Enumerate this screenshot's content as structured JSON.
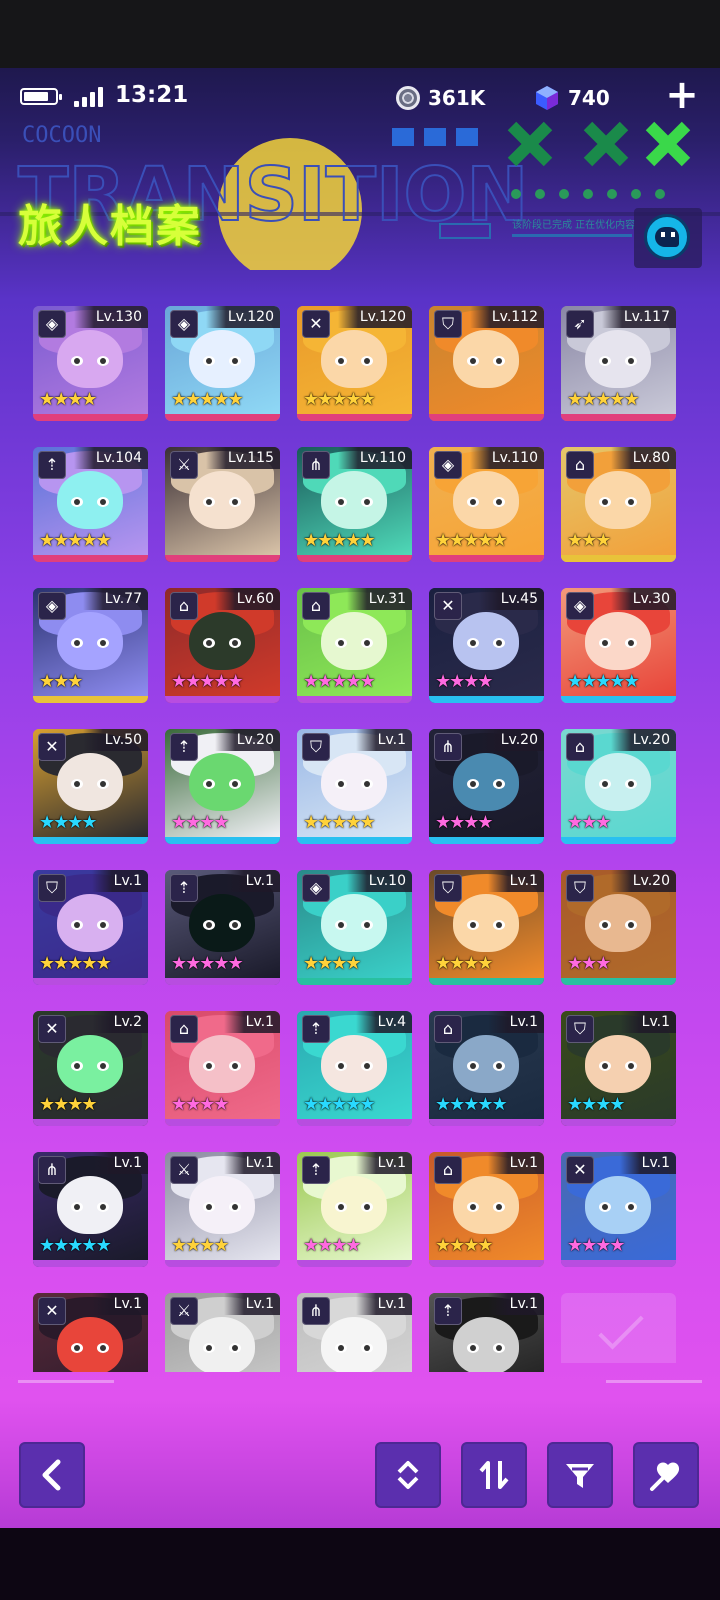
{
  "status_bar": {
    "time": "13:21",
    "battery_percent": 80
  },
  "currencies": {
    "coins": "361K",
    "gems": "740"
  },
  "header": {
    "title": "旅人档案",
    "banner_brand": "COCOON",
    "banner_word": "TRANSITION",
    "banner_subtext": "该阶段已完成  正在优化内容"
  },
  "colors": {
    "accent_lime": "#d7ff3a",
    "button_bg": "#5b2fae",
    "star_gold": "#ffd23a",
    "star_pink": "#ff6ae0",
    "star_cyan": "#29d9ff"
  },
  "characters": [
    {
      "level": "Lv.130",
      "class_icon": "diamond-icon",
      "stars": 4,
      "star_color": "#ffd23a",
      "hair": "#b27be0",
      "skin": "#d8a8f0",
      "bg": "#7a5bd0",
      "underline": "#e13f7c"
    },
    {
      "level": "Lv.120",
      "class_icon": "diamond-icon",
      "stars": 5,
      "star_color": "#ffd23a",
      "hair": "#8fd8f5",
      "skin": "#e6f0ff",
      "bg": "#6aa6d8",
      "underline": "#e13f7c"
    },
    {
      "level": "Lv.120",
      "class_icon": "crossed-swords-icon",
      "stars": 5,
      "star_color": "#ffd23a",
      "hair": "#f5b535",
      "skin": "#fbd7a8",
      "bg": "#e99a2a",
      "underline": "#e13f7c"
    },
    {
      "level": "Lv.112",
      "class_icon": "shield-icon",
      "stars": 0,
      "star_color": "#ff6ae0",
      "hair": "#f08a2a",
      "skin": "#fbd7a8",
      "bg": "#c9842f",
      "underline": "#e13f7c"
    },
    {
      "level": "Lv.117",
      "class_icon": "bow-icon",
      "stars": 5,
      "star_color": "#ffd23a",
      "hair": "#c9c9d8",
      "skin": "#e6e4ee",
      "bg": "#8a87a5",
      "underline": "#e13f7c"
    },
    {
      "level": "Lv.104",
      "class_icon": "crossbow-icon",
      "stars": 5,
      "star_color": "#ffd23a",
      "hair": "#b795f0",
      "skin": "#8ef0f0",
      "bg": "#5a72d8",
      "underline": "#e13f7c"
    },
    {
      "level": "Lv.115",
      "class_icon": "dagger-icon",
      "stars": 0,
      "star_color": "#ff6ae0",
      "hair": "#d9c3a8",
      "skin": "#f5e1cf",
      "bg": "#3a2f35",
      "underline": "#e13f7c"
    },
    {
      "level": "Lv.110",
      "class_icon": "trident-icon",
      "stars": 5,
      "star_color": "#ffd23a",
      "hair": "#4fd9b8",
      "skin": "#c5f5e6",
      "bg": "#1a5a5a",
      "underline": "#e13f7c"
    },
    {
      "level": "Lv.110",
      "class_icon": "diamond-icon",
      "stars": 5,
      "star_color": "#ffd23a",
      "hair": "#f7a436",
      "skin": "#fbd7a8",
      "bg": "#f0b050",
      "underline": "#e13f7c"
    },
    {
      "level": "Lv.80",
      "class_icon": "house-icon",
      "stars": 3,
      "star_color": "#ffd23a",
      "hair": "#f2a03a",
      "skin": "#fbd7a8",
      "bg": "#e4c66a",
      "underline": "#e8c33a"
    },
    {
      "level": "Lv.77",
      "class_icon": "diamond-icon",
      "stars": 3,
      "star_color": "#ffd23a",
      "hair": "#8e8cf0",
      "skin": "#a5a3ff",
      "bg": "#2a3270",
      "underline": "#e8c33a"
    },
    {
      "level": "Lv.60",
      "class_icon": "house-icon",
      "stars": 5,
      "star_color": "#ff6ae0",
      "hair": "#d03a2a",
      "skin": "#2c3a2a",
      "bg": "#8e2a2a",
      "underline": "#b84de0"
    },
    {
      "level": "Lv.31",
      "class_icon": "house-icon",
      "stars": 5,
      "star_color": "#ff6ae0",
      "hair": "#8ee858",
      "skin": "#e6f8d0",
      "bg": "#6ac04a",
      "underline": "#b84de0"
    },
    {
      "level": "Lv.45",
      "class_icon": "crossed-swords-icon",
      "stars": 4,
      "star_color": "#ff6ae0",
      "hair": "#2a2a4a",
      "skin": "#b8c3f0",
      "bg": "#1a2040",
      "underline": "#29c0f0"
    },
    {
      "level": "Lv.30",
      "class_icon": "diamond-icon",
      "stars": 5,
      "star_color": "#29d9ff",
      "hair": "#e8453a",
      "skin": "#fbd7c8",
      "bg": "#f29a7a",
      "underline": "#29c0f0"
    },
    {
      "level": "Lv.50",
      "class_icon": "crossed-swords-icon",
      "stars": 4,
      "star_color": "#29d9ff",
      "hair": "#2a2a30",
      "skin": "#f0e6e0",
      "bg": "#d8a030",
      "underline": "#29c0f0"
    },
    {
      "level": "Lv.20",
      "class_icon": "crossbow-icon",
      "stars": 4,
      "star_color": "#ff6ae0",
      "hair": "#f0f0f5",
      "skin": "#6ad870",
      "bg": "#3a6a3a",
      "underline": "#29c0f0"
    },
    {
      "level": "Lv.1",
      "class_icon": "shield-icon",
      "stars": 5,
      "star_color": "#ffd23a",
      "hair": "#d8e6f5",
      "skin": "#f5f0f8",
      "bg": "#9ab8e6",
      "underline": "#29c0f0"
    },
    {
      "level": "Lv.20",
      "class_icon": "trident-icon",
      "stars": 4,
      "star_color": "#ff6ae0",
      "hair": "#1a1a2a",
      "skin": "#4a8ab0",
      "bg": "#222238",
      "underline": "#29c0f0"
    },
    {
      "level": "Lv.20",
      "class_icon": "house-icon",
      "stars": 3,
      "star_color": "#ff6ae0",
      "hair": "#5ad8d0",
      "skin": "#c8f0f0",
      "bg": "#7ad8d0",
      "underline": "#29c0f0"
    },
    {
      "level": "Lv.1",
      "class_icon": "shield-icon",
      "stars": 5,
      "star_color": "#ffd23a",
      "hair": "#3a2a8a",
      "skin": "#d8b0f0",
      "bg": "#3a3aa0",
      "underline": "#b84de0"
    },
    {
      "level": "Lv.1",
      "class_icon": "crossbow-icon",
      "stars": 5,
      "star_color": "#ff6ae0",
      "hair": "#1a1a2a",
      "skin": "#0a1a18",
      "bg": "#5a5a7a",
      "underline": "#b84de0"
    },
    {
      "level": "Lv.10",
      "class_icon": "diamond-icon",
      "stars": 4,
      "star_color": "#ffd23a",
      "hair": "#3ad0c8",
      "skin": "#c8f8f0",
      "bg": "#2a8a8a",
      "underline": "#29c0a0"
    },
    {
      "level": "Lv.1",
      "class_icon": "shield-icon",
      "stars": 4,
      "star_color": "#ffd23a",
      "hair": "#f08a2a",
      "skin": "#fbd7a8",
      "bg": "#6a4a2a",
      "underline": "#29c0a0"
    },
    {
      "level": "Lv.20",
      "class_icon": "shield-icon",
      "stars": 3,
      "star_color": "#ff6ae0",
      "hair": "#b06a2a",
      "skin": "#e8b890",
      "bg": "#a85a2a",
      "underline": "#29c0a0"
    },
    {
      "level": "Lv.2",
      "class_icon": "crossed-swords-icon",
      "stars": 4,
      "star_color": "#ffd23a",
      "hair": "#2a2a30",
      "skin": "#7af0a0",
      "bg": "#2a3a2a",
      "underline": "#b84de0"
    },
    {
      "level": "Lv.1",
      "class_icon": "house-icon",
      "stars": 4,
      "star_color": "#ff6ae0",
      "hair": "#f06a8a",
      "skin": "#f5c0c8",
      "bg": "#d84a6a",
      "underline": "#b84de0"
    },
    {
      "level": "Lv.4",
      "class_icon": "crossbow-icon",
      "stars": 5,
      "star_color": "#29d9ff",
      "hair": "#3ad8d0",
      "skin": "#f5e6e0",
      "bg": "#2aa8b0",
      "underline": "#b84de0"
    },
    {
      "level": "Lv.1",
      "class_icon": "house-icon",
      "stars": 5,
      "star_color": "#29d9ff",
      "hair": "#1a2a40",
      "skin": "#8aa8c8",
      "bg": "#2a3a50",
      "underline": "#b84de0"
    },
    {
      "level": "Lv.1",
      "class_icon": "shield-icon",
      "stars": 4,
      "star_color": "#29d9ff",
      "hair": "#2a3a2a",
      "skin": "#f5d0b0",
      "bg": "#3a4a1a",
      "underline": "#b84de0"
    },
    {
      "level": "Lv.1",
      "class_icon": "trident-icon",
      "stars": 5,
      "star_color": "#29d9ff",
      "hair": "#1a1a2a",
      "skin": "#f0f0f5",
      "bg": "#3a2a6a",
      "underline": "#b84de0"
    },
    {
      "level": "Lv.1",
      "class_icon": "dagger-icon",
      "stars": 4,
      "star_color": "#ffd23a",
      "hair": "#e6e6f0",
      "skin": "#f5f0f8",
      "bg": "#8a8aa0",
      "underline": "#b84de0"
    },
    {
      "level": "Lv.1",
      "class_icon": "crossbow-icon",
      "stars": 4,
      "star_color": "#ff6ae0",
      "hair": "#e8f8d0",
      "skin": "#f8f5d0",
      "bg": "#9ac850",
      "underline": "#b84de0"
    },
    {
      "level": "Lv.1",
      "class_icon": "house-icon",
      "stars": 4,
      "star_color": "#ffd23a",
      "hair": "#f08a2a",
      "skin": "#fbd7a8",
      "bg": "#c85a2a",
      "underline": "#b84de0"
    },
    {
      "level": "Lv.1",
      "class_icon": "crossed-swords-icon",
      "stars": 4,
      "star_color": "#ff6ae0",
      "hair": "#3a6ad8",
      "skin": "#a8d0f5",
      "bg": "#4a6ab0",
      "underline": "#b84de0"
    },
    {
      "level": "Lv.1",
      "class_icon": "crossed-swords-icon",
      "stars": 0,
      "star_color": "#ffd23a",
      "hair": "#2a1a2a",
      "skin": "#e8453a",
      "bg": "#5a2a3a",
      "underline": "#b84de0"
    },
    {
      "level": "Lv.1",
      "class_icon": "dagger-icon",
      "stars": 0,
      "star_color": "#ffd23a",
      "hair": "#cfcfcf",
      "skin": "#f0f0f0",
      "bg": "#9a9a9a",
      "underline": "#b84de0"
    },
    {
      "level": "Lv.1",
      "class_icon": "trident-icon",
      "stars": 0,
      "star_color": "#ffd23a",
      "hair": "#d8d8d8",
      "skin": "#f5f5f5",
      "bg": "#bdbdbd",
      "underline": "#b84de0"
    },
    {
      "level": "Lv.1",
      "class_icon": "crossbow-icon",
      "stars": 0,
      "star_color": "#ffd23a",
      "hair": "#1a1a1a",
      "skin": "#d0d0d0",
      "bg": "#555555",
      "underline": "#b84de0"
    }
  ],
  "toolbar": {
    "back_icon": "chevron-left-icon",
    "sort_icon": "sort-up-down-icon",
    "swap_icon": "swap-arrows-icon",
    "filter_icon": "filter-icon",
    "favorite_icon": "heart-pin-icon"
  }
}
